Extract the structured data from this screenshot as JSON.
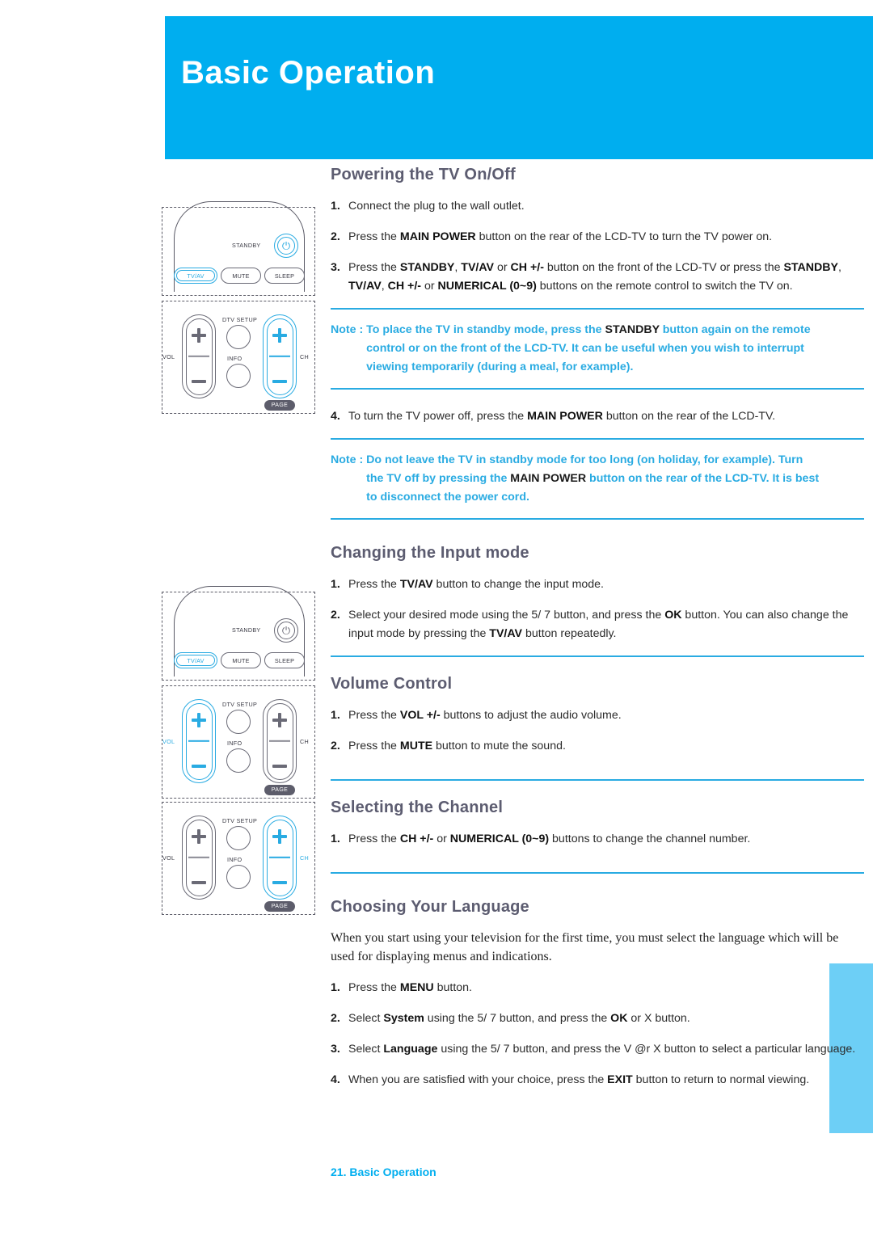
{
  "page": {
    "banner_title": "Basic Operation",
    "footer": "21. Basic Operation",
    "accent_blue": "#00AEEF",
    "rule_blue": "#29ABE2",
    "side_tab_blue": "#6DCFF6",
    "heading_gray": "#5C5C70"
  },
  "sections": {
    "powering": {
      "heading": "Powering the TV On/Off",
      "steps": [
        {
          "num": "1.",
          "parts": [
            {
              "t": "Connect the plug to the wall outlet.",
              "b": false
            }
          ]
        },
        {
          "num": "2.",
          "parts": [
            {
              "t": "Press the ",
              "b": false
            },
            {
              "t": "MAIN POWER",
              "b": true
            },
            {
              "t": " button on the rear of the LCD-TV to turn the TV power on.",
              "b": false
            }
          ]
        },
        {
          "num": "3.",
          "parts": [
            {
              "t": "Press the ",
              "b": false
            },
            {
              "t": "STANDBY",
              "b": true
            },
            {
              "t": ", ",
              "b": false
            },
            {
              "t": "TV/AV",
              "b": true
            },
            {
              "t": " or ",
              "b": false
            },
            {
              "t": "CH +/-",
              "b": true
            },
            {
              "t": " button on the front of the LCD-TV or press the ",
              "b": false
            },
            {
              "t": "STANDBY",
              "b": true
            },
            {
              "t": ", ",
              "b": false
            },
            {
              "t": "TV/AV",
              "b": true
            },
            {
              "t": ", ",
              "b": false
            },
            {
              "t": "CH +/-",
              "b": true
            },
            {
              "t": " or ",
              "b": false
            },
            {
              "t": "NUMERICAL (0~9)",
              "b": true
            },
            {
              "t": " buttons on the remote control to switch the TV on.",
              "b": false
            }
          ]
        }
      ],
      "step4": {
        "num": "4.",
        "parts": [
          {
            "t": "To turn the TV power off, press the ",
            "b": false
          },
          {
            "t": "MAIN POWER",
            "b": true
          },
          {
            "t": " button on the rear of the LCD-TV.",
            "b": false
          }
        ]
      }
    },
    "note1": {
      "label": "Note : ",
      "parts": [
        {
          "t": "To place the TV in standby mode, press the ",
          "b": false
        },
        {
          "t": "STANDBY",
          "b": true
        },
        {
          "t": " button again on the remote control or on the front of the LCD-TV. It can be useful when you wish to interrupt viewing temporarily (during a meal, for example).",
          "b": false
        }
      ]
    },
    "note2": {
      "label": "Note : ",
      "parts": [
        {
          "t": "Do not leave the TV in standby mode for too long (on holiday, for example). Turn the TV off by pressing the ",
          "b": false
        },
        {
          "t": "MAIN POWER",
          "b": true
        },
        {
          "t": " button on the rear of the LCD-TV. It is best to disconnect the power cord.",
          "b": false
        }
      ]
    },
    "input_mode": {
      "heading": "Changing the Input mode",
      "steps": [
        {
          "num": "1.",
          "parts": [
            {
              "t": "Press the ",
              "b": false
            },
            {
              "t": "TV/AV",
              "b": true
            },
            {
              "t": " button to change the input mode.",
              "b": false
            }
          ]
        },
        {
          "num": "2.",
          "parts": [
            {
              "t": "Select your desired mode using the  5/ 7 button, and press the ",
              "b": false
            },
            {
              "t": "OK",
              "b": true
            },
            {
              "t": " button. You can also change the input mode by pressing the ",
              "b": false
            },
            {
              "t": "TV/AV",
              "b": true
            },
            {
              "t": " button repeatedly.",
              "b": false
            }
          ]
        }
      ]
    },
    "volume": {
      "heading": "Volume Control",
      "steps": [
        {
          "num": "1.",
          "parts": [
            {
              "t": "Press the ",
              "b": false
            },
            {
              "t": "VOL +/-",
              "b": true
            },
            {
              "t": " buttons to adjust the audio volume.",
              "b": false
            }
          ]
        },
        {
          "num": "2.",
          "parts": [
            {
              "t": "Press the ",
              "b": false
            },
            {
              "t": "MUTE",
              "b": true
            },
            {
              "t": " button to mute the sound.",
              "b": false
            }
          ]
        }
      ]
    },
    "channel": {
      "heading": "Selecting the Channel",
      "steps": [
        {
          "num": "1.",
          "parts": [
            {
              "t": "Press the ",
              "b": false
            },
            {
              "t": "CH +/-",
              "b": true
            },
            {
              "t": " or ",
              "b": false
            },
            {
              "t": "NUMERICAL (0~9)",
              "b": true
            },
            {
              "t": " buttons to change the channel number.",
              "b": false
            }
          ]
        }
      ]
    },
    "language": {
      "heading": "Choosing Your Language",
      "intro": "When you start using your television for the first time,  you must select the language which will be used for displaying menus and indications.",
      "steps": [
        {
          "num": "1.",
          "parts": [
            {
              "t": "Press the ",
              "b": false
            },
            {
              "t": "MENU",
              "b": true
            },
            {
              "t": " button.",
              "b": false
            }
          ]
        },
        {
          "num": "2.",
          "parts": [
            {
              "t": "Select ",
              "b": false
            },
            {
              "t": "System",
              "b": true
            },
            {
              "t": " using the  5/ 7 button, and press the ",
              "b": false
            },
            {
              "t": "OK",
              "b": true
            },
            {
              "t": " or  X button.",
              "b": false
            }
          ]
        },
        {
          "num": "3.",
          "parts": [
            {
              "t": "Select ",
              "b": false
            },
            {
              "t": "Language",
              "b": true
            },
            {
              "t": " using the  5/ 7 button, and press the  V @r  X button to select a particular language.",
              "b": false
            }
          ]
        },
        {
          "num": "4.",
          "parts": [
            {
              "t": "When you are satisfied with your choice, press the ",
              "b": false
            },
            {
              "t": "EXIT",
              "b": true
            },
            {
              "t": " button to return to normal viewing.",
              "b": false
            }
          ]
        }
      ]
    }
  },
  "remotes": {
    "labels": {
      "standby": "STANDBY",
      "tvav": "TV/AV",
      "mute": "MUTE",
      "sleep": "SLEEP",
      "vol": "VOL",
      "ch": "CH",
      "dtv_setup": "DTV SETUP",
      "info": "INFO",
      "page": "PAGE",
      "power_glyph": "⏻"
    },
    "diagram1": {
      "highlight": [
        "standby-power",
        "tvav",
        "ch-rocker"
      ]
    },
    "diagram2": {
      "highlight": [
        "tvav",
        "vol-rocker"
      ]
    },
    "diagram3": {
      "highlight": [
        "ch-rocker"
      ]
    }
  }
}
